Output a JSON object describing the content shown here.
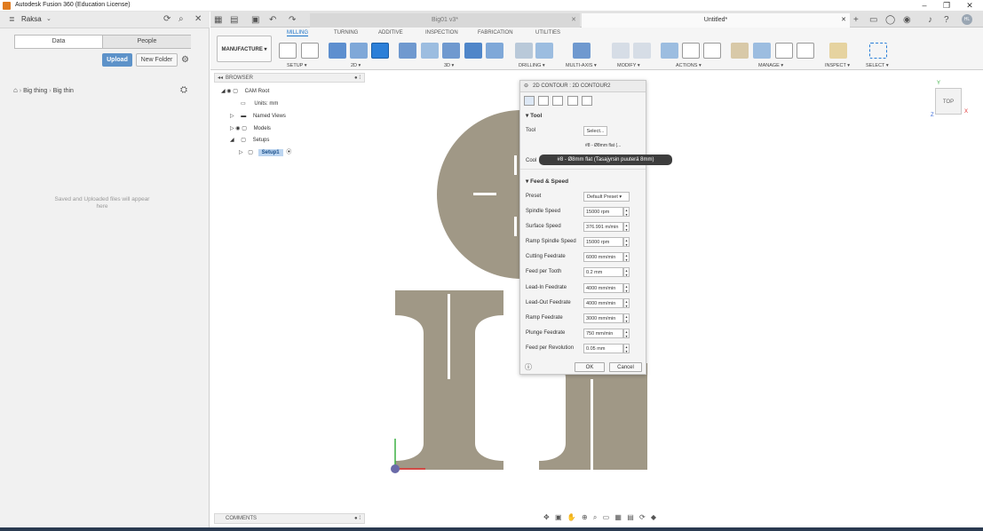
{
  "window": {
    "title": "Autodesk Fusion 360 (Education License)",
    "minimize": "–",
    "restore": "❐",
    "close": "✕"
  },
  "data_panel": {
    "team": "Raksa",
    "tabs": [
      "Data",
      "People"
    ],
    "upload_label": "Upload",
    "new_folder_label": "New Folder",
    "breadcrumb": [
      "Big thing",
      "Big thin"
    ],
    "empty_message": "Saved and Uploaded files will appear here"
  },
  "doc_tabs": [
    {
      "label": "Big01 v3*"
    },
    {
      "label": "Untitled*"
    }
  ],
  "toolbar": {
    "workspace": "MANUFACTURE",
    "tabs": [
      "MILLING",
      "TURNING",
      "ADDITIVE",
      "INSPECTION",
      "FABRICATION",
      "UTILITIES"
    ],
    "active_tab": "MILLING",
    "groups": [
      "SETUP",
      "2D",
      "3D",
      "DRILLING",
      "MULTI-AXIS",
      "MODIFY",
      "ACTIONS",
      "MANAGE",
      "INSPECT",
      "SELECT"
    ]
  },
  "browser": {
    "header": "BROWSER",
    "items": [
      {
        "label": "CAM Root"
      },
      {
        "label": "Units: mm"
      },
      {
        "label": "Named Views"
      },
      {
        "label": "Models"
      },
      {
        "label": "Setups"
      },
      {
        "label": "Setup1"
      }
    ]
  },
  "comments": {
    "header": "COMMENTS"
  },
  "dialog": {
    "title": "2D CONTOUR : 2D CONTOUR2",
    "tool_section": "Tool",
    "tool_label": "Tool",
    "tool_select": "Select...",
    "tool_desc": "#8 - Ø8mm flat (...",
    "coolant_label": "Cool",
    "tooltip": "#8 - Ø8mm flat (Tasajyrsin puuterä 8mm)",
    "feed_section": "Feed & Speed",
    "preset_label": "Preset",
    "preset_value": "Default Preset",
    "fields": [
      {
        "label": "Spindle Speed",
        "value": "15000 rpm"
      },
      {
        "label": "Surface Speed",
        "value": "376.991 m/min"
      },
      {
        "label": "Ramp Spindle Speed",
        "value": "15000 rpm"
      },
      {
        "label": "Cutting Feedrate",
        "value": "6000 mm/min"
      },
      {
        "label": "Feed per Tooth",
        "value": "0.2 mm"
      },
      {
        "label": "Lead-In Feedrate",
        "value": "4000 mm/min"
      },
      {
        "label": "Lead-Out Feedrate",
        "value": "4000 mm/min"
      },
      {
        "label": "Ramp Feedrate",
        "value": "3000 mm/min"
      },
      {
        "label": "Plunge Feedrate",
        "value": "750 mm/min"
      },
      {
        "label": "Feed per Revolution",
        "value": "0.05 mm"
      }
    ],
    "ok_label": "OK",
    "cancel_label": "Cancel"
  },
  "viewcube": {
    "label": "TOP",
    "axis_x": "X",
    "axis_y": "Y",
    "axis_z": "Z"
  },
  "colors": {
    "part": "#a09886",
    "accent": "#1a73c9",
    "upload": "#5d92c9"
  }
}
